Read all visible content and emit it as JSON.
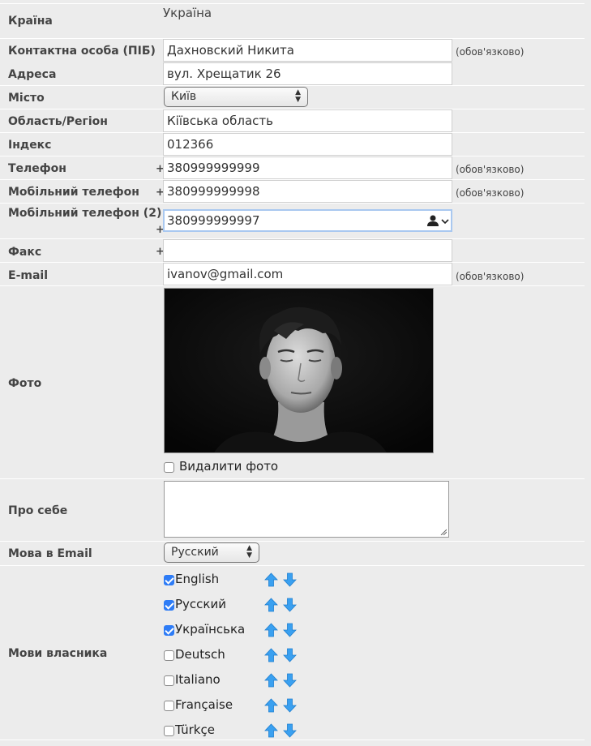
{
  "form": {
    "country": {
      "label": "Країна",
      "value": "Україна"
    },
    "contact": {
      "label": "Контактна особа (ПІБ)",
      "value": "Дахновский Никита",
      "note": "(обов'язково)"
    },
    "address": {
      "label": "Адреса",
      "value": "вул. Хрещатик 26"
    },
    "city": {
      "label": "Місто",
      "value": "Київ"
    },
    "region": {
      "label": "Область/Регіон",
      "value": "Кіївська область"
    },
    "zip": {
      "label": "Індекс",
      "value": "012366"
    },
    "phone": {
      "label": "Телефон",
      "prefix": "+",
      "value": "380999999999",
      "note": "(обов'язково)"
    },
    "mobile": {
      "label": "Мобільний телефон",
      "prefix": "+",
      "value": "380999999998",
      "note": "(обов'язково)"
    },
    "mobile2": {
      "label": "Мобільний телефон (2)",
      "prefix": "+",
      "value": "380999999997",
      "autofill_icon": "contact-autofill-icon"
    },
    "fax": {
      "label": "Факс",
      "prefix": "+",
      "value": ""
    },
    "email": {
      "label": "E-mail",
      "value": "ivanov@gmail.com",
      "note": "(обов'язково)"
    },
    "photo": {
      "label": "Фото",
      "delete_label": "Видалити фото",
      "delete_checked": false
    },
    "about": {
      "label": "Про себе",
      "value": ""
    },
    "email_lang": {
      "label": "Мова в Email",
      "value": "Русский"
    },
    "owner_langs": {
      "label": "Мови власника",
      "items": [
        {
          "name": "English",
          "checked": true
        },
        {
          "name": "Русский",
          "checked": true
        },
        {
          "name": "Українська",
          "checked": true
        },
        {
          "name": "Deutsch",
          "checked": false
        },
        {
          "name": "Italiano",
          "checked": false
        },
        {
          "name": "Française",
          "checked": false
        },
        {
          "name": "Türkçe",
          "checked": false
        }
      ]
    }
  },
  "colors": {
    "background": "#ececec",
    "checkbox_checked": "#2e7cf6",
    "arrow_blue": "#3aa0f0"
  }
}
